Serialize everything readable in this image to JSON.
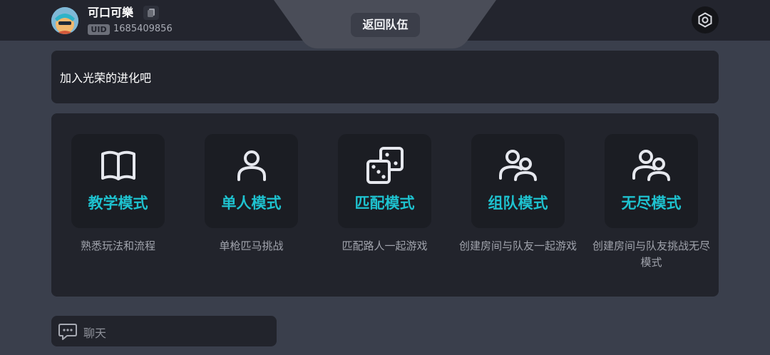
{
  "header": {
    "username": "可口可樂",
    "uid_label": "UID",
    "uid_value": "1685409856",
    "back_button_label": "返回队伍"
  },
  "banner": {
    "text": "加入光荣的进化吧"
  },
  "modes": [
    {
      "icon": "book-icon",
      "title": "教学模式",
      "description": "熟悉玩法和流程"
    },
    {
      "icon": "person-icon",
      "title": "单人模式",
      "description": "单枪匹马挑战"
    },
    {
      "icon": "dice-icon",
      "title": "匹配模式",
      "description": "匹配路人一起游戏"
    },
    {
      "icon": "group-icon",
      "title": "组队模式",
      "description": "创建房间与队友一起游戏"
    },
    {
      "icon": "group-icon",
      "title": "无尽模式",
      "description": "创建房间与队友挑战无尽模式"
    }
  ],
  "chat": {
    "placeholder": "聊天"
  },
  "colors": {
    "accent": "#1ec2cf",
    "background": "#3a3f4c",
    "panel": "#22242c"
  }
}
